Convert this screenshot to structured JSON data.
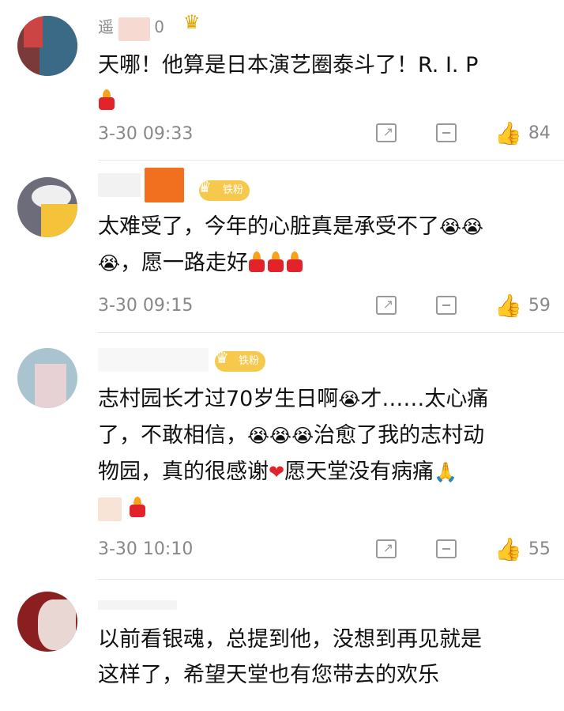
{
  "comments": [
    {
      "name": "遥",
      "name_suffix": "0",
      "badge": "",
      "text": "天哪！他算是日本演艺圈泰斗了！R. I. P",
      "time": "3-30 09:33",
      "likes": "84"
    },
    {
      "name": "",
      "badge": "铁粉",
      "text_line1": "太难受了，今年的心脏真是承受不了",
      "text_line2": "，愿一路走好",
      "time": "3-30 09:15",
      "likes": "59"
    },
    {
      "name": "",
      "badge": "铁粉",
      "text_line1": "志村园长才过70岁生日啊",
      "text_line1b": "才……太心痛",
      "text_line2a": "了，不敢相信，",
      "text_line2b": "治愈了我的志村动",
      "text_line3a": "物园，真的很感谢",
      "text_line3b": "愿天堂没有病痛",
      "time": "3-30 10:10",
      "likes": "55"
    },
    {
      "name": "",
      "badge": "",
      "text_line1": "以前看银魂，总提到他，没想到再见就是",
      "text_line2": "这样了，希望天堂也有您带去的欢乐"
    }
  ],
  "icons": {
    "share": "share-icon",
    "comment": "comment-icon",
    "like": "like-icon",
    "crown": "crown-icon",
    "cry": "crying-face-icon",
    "candle": "candle-icon",
    "heart": "heart-icon",
    "pray": "pray-icon"
  },
  "emojis": {
    "cry": "😭",
    "heart": "❤",
    "pray": "🙏"
  },
  "colors": {
    "badge": "#f6c84c",
    "candle": "#e2232a",
    "flame": "#f7a21b",
    "meta": "#888888"
  }
}
